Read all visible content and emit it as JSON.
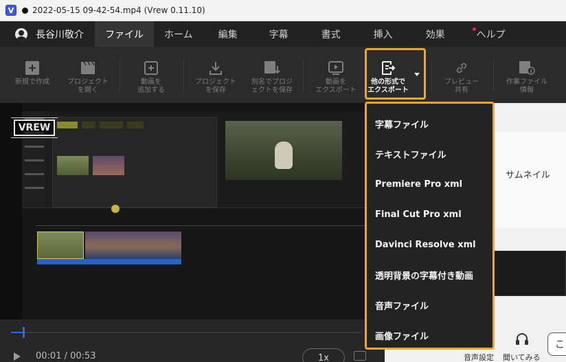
{
  "window": {
    "logo_text": "V",
    "title": "2022-05-15 09-42-54.mp4 (Vrew 0.11.10)"
  },
  "menubar": {
    "user_name": "長谷川敬介",
    "tabs": [
      {
        "label": "ファイル",
        "active": true
      },
      {
        "label": "ホーム"
      },
      {
        "label": "編集"
      },
      {
        "label": "字幕"
      },
      {
        "label": "書式"
      },
      {
        "label": "挿入"
      },
      {
        "label": "効果"
      },
      {
        "label": "ヘルプ",
        "badge_color": "#e8294b"
      }
    ]
  },
  "toolbar": {
    "new": "新規で作成",
    "open": "プロジェクト\nを開く",
    "add_video": "動画を\n追加する",
    "save": "プロジェクト\nを保存",
    "save_as": "別名でプロジ\nェクトを保存",
    "export_video": "動画を\nエクスポート",
    "export_other": "他の形式で\nエクスポート",
    "preview_share": "プレビュー\n共有",
    "project_info": "作業ファイル\n情報"
  },
  "export_menu": {
    "items": [
      "字幕ファイル",
      "テキストファイル",
      "Premiere Pro xml",
      "Final Cut Pro xml",
      "Davinci Resolve xml",
      "透明背景の字幕付き動画",
      "音声ファイル",
      "画像ファイル"
    ],
    "highlight_color": "#f5a623"
  },
  "preview": {
    "watermark": "VREW"
  },
  "right_panel": {
    "thumbnail_label": "サムネイル"
  },
  "player": {
    "time": "00:01 / 00:53",
    "progress": 0.035,
    "speed": "1x",
    "audio_settings": "音声設定",
    "listen": "聞いてみる",
    "close_char": "こ"
  }
}
